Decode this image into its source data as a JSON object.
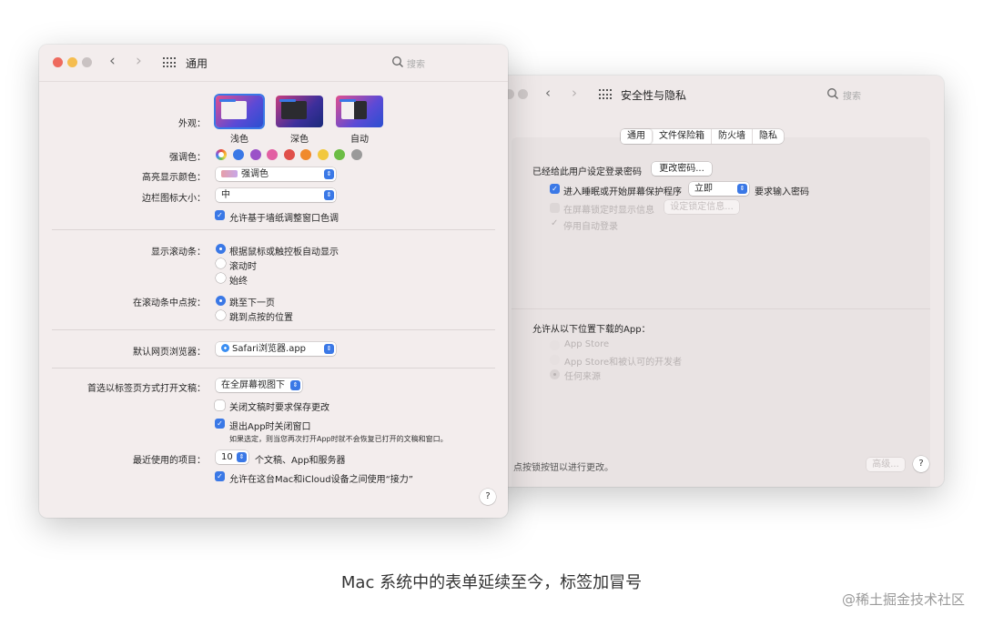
{
  "back_window": {
    "title": "安全性与隐私",
    "search_placeholder": "搜索",
    "tabs": [
      "通用",
      "文件保险箱",
      "防火墙",
      "隐私"
    ],
    "login_password_label": "已经给此用户设定登录密码",
    "change_password_button": "更改密码...",
    "require_password_label": "进入睡眠或开始屏幕保护程序",
    "require_password_delay": "立即",
    "require_password_suffix": "要求输入密码",
    "show_message_label": "在屏幕锁定时显示信息",
    "set_lock_message_button": "设定锁定信息...",
    "disable_autologin_label": "停用自动登录",
    "allow_apps_label": "允许从以下位置下载的App：",
    "app_sources": [
      "App Store",
      "App Store和被认可的开发者",
      "任何来源"
    ],
    "lock_text": "点按锁按钮以进行更改。",
    "advanced_button": "高级...",
    "help_label": "?"
  },
  "front_window": {
    "title": "通用",
    "search_placeholder": "搜索",
    "appearance_label": "外观：",
    "appearance_options": [
      "浅色",
      "深色",
      "自动"
    ],
    "accent_label": "强调色：",
    "accent_colors": [
      "#3a78e6",
      "#9b52c8",
      "#e25fa3",
      "#e0504a",
      "#f08a2b",
      "#f2c83d",
      "#6cbd45",
      "#9a9a9a"
    ],
    "highlight_label": "高亮显示颜色：",
    "highlight_value": "强调色",
    "sidebar_icon_label": "边栏图标大小：",
    "sidebar_icon_value": "中",
    "wallpaper_tint_label": "允许基于墙纸调整窗口色调",
    "show_scrollbars_label": "显示滚动条：",
    "show_scrollbars_options": [
      "根据鼠标或触控板自动显示",
      "滚动时",
      "始终"
    ],
    "click_scrollbar_label": "在滚动条中点按：",
    "click_scrollbar_options": [
      "跳至下一页",
      "跳到点按的位置"
    ],
    "default_browser_label": "默认网页浏览器：",
    "default_browser_value": "Safari浏览器.app",
    "prefer_tabs_label": "首选以标签页方式打开文稿：",
    "prefer_tabs_value": "在全屏幕视图下",
    "ask_keep_changes_label": "关闭文稿时要求保存更改",
    "close_windows_label": "退出App时关闭窗口",
    "close_windows_note": "如果选定，则当您再次打开App时就不会恢复已打开的文稿和窗口。",
    "recent_items_label": "最近使用的项目：",
    "recent_items_value": "10",
    "recent_items_suffix": "个文稿、App和服务器",
    "handoff_label": "允许在这台Mac和iCloud设备之间使用“接力”",
    "help_label": "?"
  },
  "caption": "Mac  系统中的表单延续至今，标签加冒号",
  "watermark": "@稀土掘金技术社区"
}
